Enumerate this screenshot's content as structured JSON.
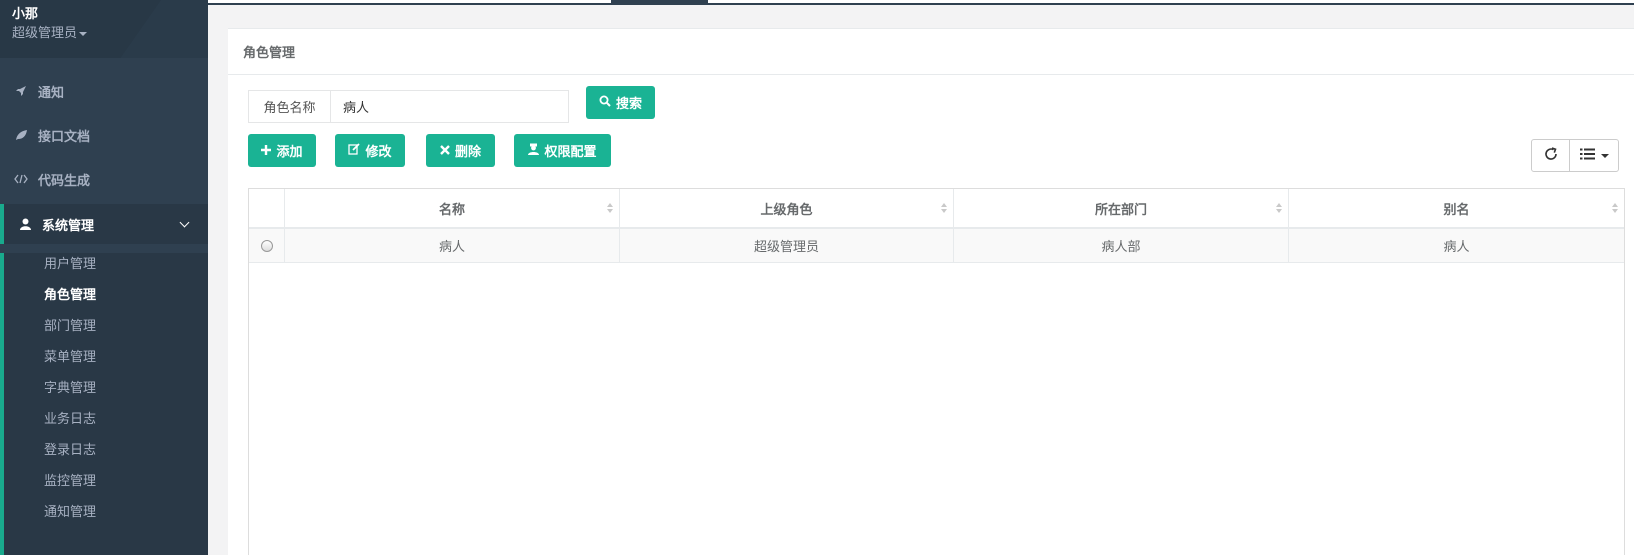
{
  "profile": {
    "name": "小那",
    "role": "超级管理员"
  },
  "nav": {
    "items": [
      {
        "label": "通知",
        "icon": "rocket-icon"
      },
      {
        "label": "接口文档",
        "icon": "leaf-icon"
      },
      {
        "label": "代码生成",
        "icon": "code-icon"
      },
      {
        "label": "系统管理",
        "icon": "user-icon"
      }
    ],
    "submenu": [
      "用户管理",
      "角色管理",
      "部门管理",
      "菜单管理",
      "字典管理",
      "业务日志",
      "登录日志",
      "监控管理",
      "通知管理"
    ]
  },
  "panel": {
    "title": "角色管理",
    "search": {
      "label": "角色名称",
      "value": "病人",
      "button": "搜索"
    },
    "actions": {
      "add": "添加",
      "edit": "修改",
      "delete": "删除",
      "permission": "权限配置"
    }
  },
  "table": {
    "columns": [
      "名称",
      "上级角色",
      "所在部门",
      "别名"
    ],
    "rows": [
      [
        "病人",
        "超级管理员",
        "病人部",
        "病人"
      ]
    ]
  },
  "colors": {
    "sidebar": "#2f4050",
    "accent": "#1ab394"
  }
}
